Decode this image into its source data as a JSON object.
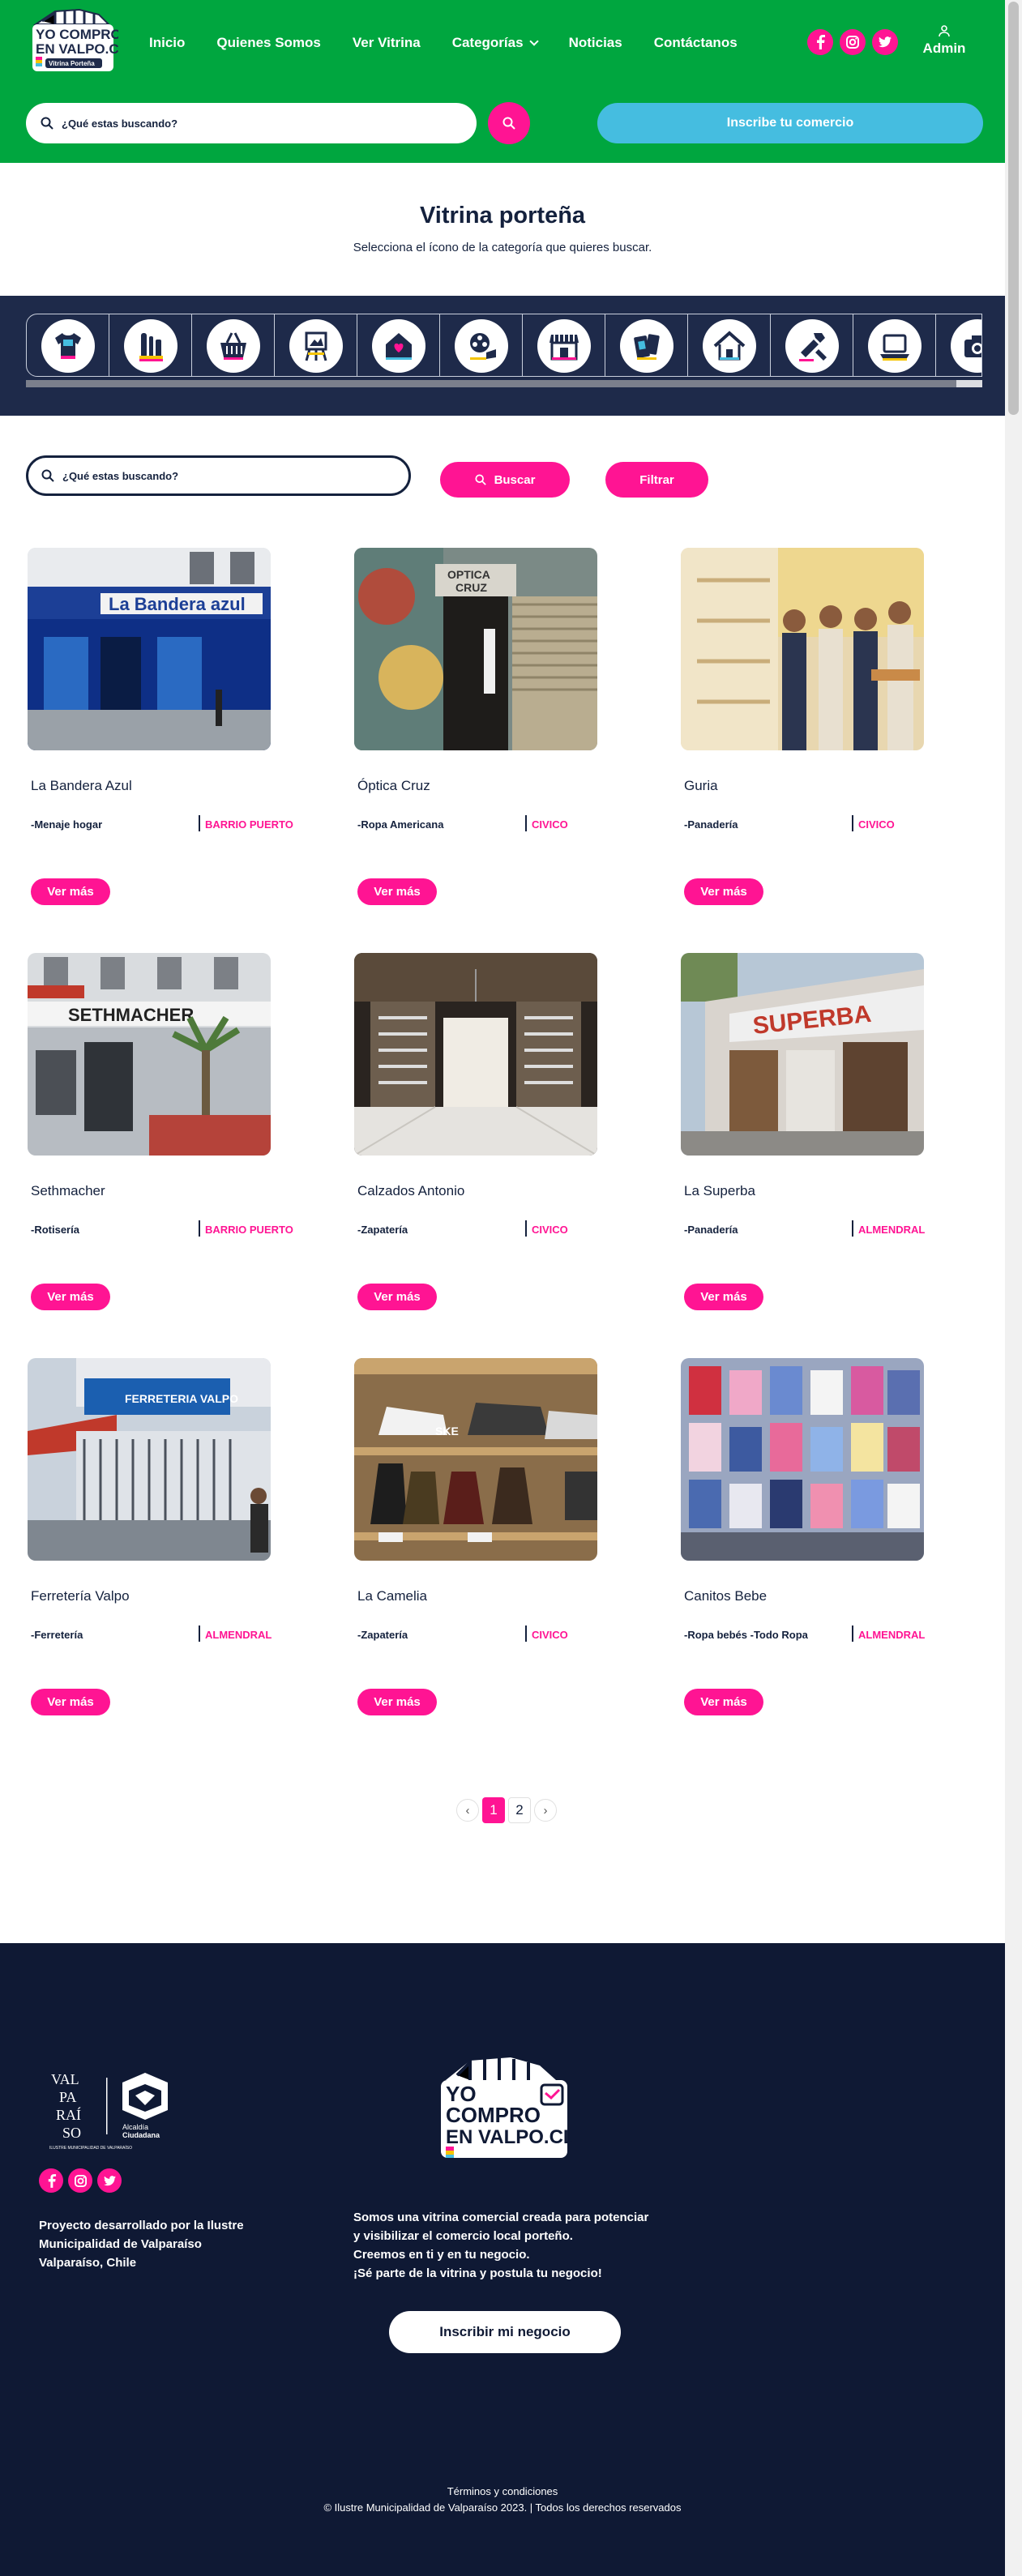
{
  "header": {
    "logo_text": "YO COMPRO EN VALPO.CL Vitrina Porteña",
    "nav": [
      {
        "label": "Inicio"
      },
      {
        "label": "Quienes Somos"
      },
      {
        "label": "Ver Vitrina"
      },
      {
        "label": "Categorías"
      },
      {
        "label": "Noticias"
      },
      {
        "label": "Contáctanos"
      }
    ],
    "social": [
      "facebook-icon",
      "instagram-icon",
      "twitter-icon"
    ],
    "admin_label": "Admin",
    "search_placeholder": "¿Qué estas buscando?",
    "register_label": "Inscribe tu comercio"
  },
  "intro": {
    "title": "Vitrina porteña",
    "subtitle": "Selecciona el ícono de la categoría que quieres buscar."
  },
  "categories": [
    {
      "icon": "tshirt-icon"
    },
    {
      "icon": "tools-icon"
    },
    {
      "icon": "basket-icon"
    },
    {
      "icon": "easel-icon"
    },
    {
      "icon": "home-heart-icon"
    },
    {
      "icon": "film-reel-icon"
    },
    {
      "icon": "storefront-icon"
    },
    {
      "icon": "phone-tablet-icon"
    },
    {
      "icon": "house-icon"
    },
    {
      "icon": "hardware-tools-icon"
    },
    {
      "icon": "laptop-icon"
    },
    {
      "icon": "camera-icon"
    }
  ],
  "filter": {
    "search_placeholder": "¿Qué estas buscando?",
    "search_button": "Buscar",
    "filter_button": "Filtrar"
  },
  "stores": [
    {
      "name": "La Bandera Azul",
      "category": "-Menaje hogar",
      "barrio": "BARRIO PUERTO",
      "button": "Ver más"
    },
    {
      "name": "Óptica Cruz",
      "category": "-Ropa Americana",
      "barrio": "CIVICO",
      "button": "Ver más"
    },
    {
      "name": "Guria",
      "category": "-Panadería",
      "barrio": "CIVICO",
      "button": "Ver más"
    },
    {
      "name": "Sethmacher",
      "category": "-Rotisería",
      "barrio": "BARRIO PUERTO",
      "button": "Ver más"
    },
    {
      "name": "Calzados Antonio",
      "category": "-Zapatería",
      "barrio": "CIVICO",
      "button": "Ver más"
    },
    {
      "name": "La Superba",
      "category": "-Panadería",
      "barrio": "ALMENDRAL",
      "button": "Ver más"
    },
    {
      "name": "Ferretería Valpo",
      "category": "-Ferretería",
      "barrio": "ALMENDRAL",
      "button": "Ver más"
    },
    {
      "name": "La Camelia",
      "category": "-Zapatería",
      "barrio": "CIVICO",
      "button": "Ver más"
    },
    {
      "name": "Canitos Bebe",
      "category": "-Ropa bebés -Todo Ropa",
      "barrio": "ALMENDRAL",
      "button": "Ver más"
    }
  ],
  "pagination": {
    "prev": "‹",
    "pages": [
      "1",
      "2"
    ],
    "current": "1",
    "next": "›"
  },
  "footer": {
    "org_logo_text": "VALPARAÍSO Alcaldía Ciudadana ILUSTRE MUNICIPALIDAD DE VALPARAÍSO",
    "project_lines": [
      "Proyecto desarrollado por la Ilustre",
      "Municipalidad de Valparaíso",
      "Valparaíso, Chile"
    ],
    "desc_lines": [
      "Somos una vitrina comercial creada para potenciar",
      "y visibilizar el comercio local porteño.",
      "Creemos en ti y en tu negocio.",
      "¡Sé parte de la vitrina y postula tu negocio!"
    ],
    "cta": "Inscribir mi negocio",
    "terms": "Términos y condiciones",
    "copyright": "© Ilustre Municipalidad de Valparaíso 2023. | Todos los derechos reservados"
  },
  "colors": {
    "green": "#00a63f",
    "pink": "#ff1493",
    "navy": "#14213d",
    "sky": "#45bde0",
    "footer": "#0f1934"
  }
}
